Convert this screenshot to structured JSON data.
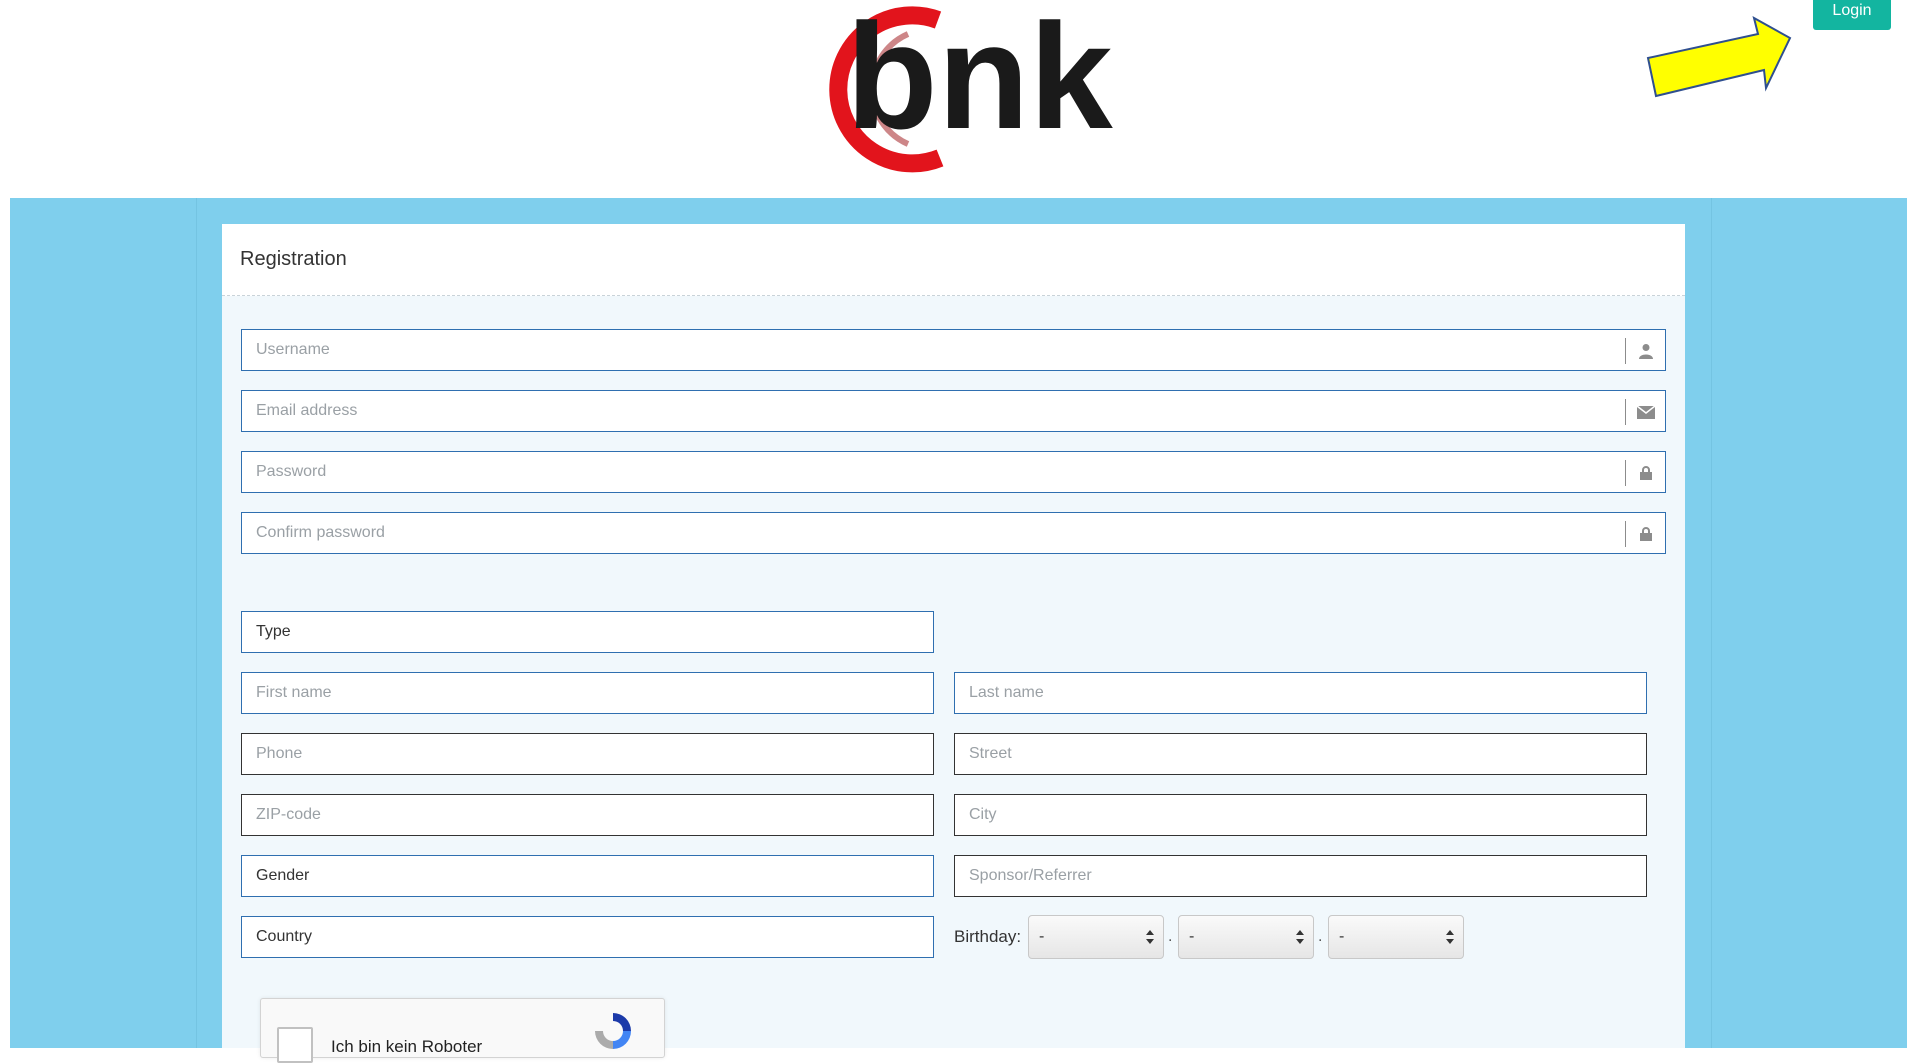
{
  "header": {
    "logo_text": "bnk",
    "login_label": "Login"
  },
  "form": {
    "title": "Registration",
    "username_placeholder": "Username",
    "email_placeholder": "Email address",
    "password_placeholder": "Password",
    "confirm_password_placeholder": "Confirm password",
    "type_label": "Type",
    "first_name_placeholder": "First name",
    "last_name_placeholder": "Last name",
    "phone_placeholder": "Phone",
    "street_placeholder": "Street",
    "zip_placeholder": "ZIP-code",
    "city_placeholder": "City",
    "gender_label": "Gender",
    "sponsor_placeholder": "Sponsor/Referrer",
    "country_label": "Country",
    "birthday_label": "Birthday:",
    "birthday_day": "-",
    "birthday_month": "-",
    "birthday_year": "-",
    "birthday_sep": "."
  },
  "captcha": {
    "label": "Ich bin kein Roboter"
  },
  "colors": {
    "accent": "#13b5a0",
    "background": "#7fcfed",
    "field_border": "#2f6fb0",
    "logo_red": "#e2141c",
    "logo_dark": "#1a1a1a",
    "arrow_yellow": "#ffff00"
  }
}
